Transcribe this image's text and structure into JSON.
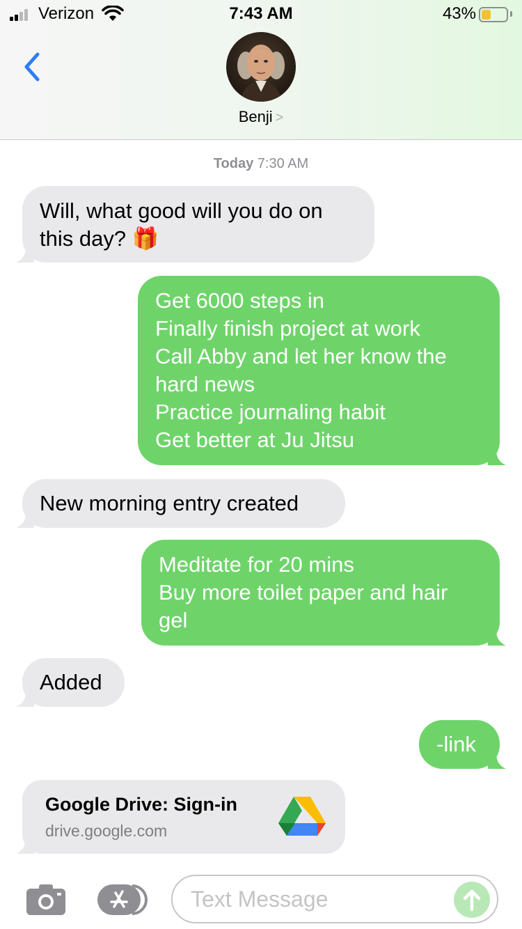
{
  "status_bar": {
    "carrier": "Verizon",
    "time": "7:43 AM",
    "battery_percent": "43%",
    "battery_level": 0.43,
    "signal_bars_active": 2,
    "icons": [
      "signal-icon",
      "wifi-icon",
      "battery-icon"
    ]
  },
  "header": {
    "back_icon": "chevron-left-icon",
    "contact_name": "Benji",
    "contact_chevron": ">"
  },
  "thread": {
    "timestamp_day": "Today",
    "timestamp_time": "7:30 AM",
    "messages": [
      {
        "direction": "incoming",
        "lines": [
          "Will, what good will you do on",
          "this day? 🎁"
        ]
      },
      {
        "direction": "outgoing",
        "lines": [
          "Get 6000 steps in",
          "Finally finish project at work",
          "Call Abby and let her know the",
          "hard news",
          "Practice journaling habit",
          "Get better at Ju Jitsu"
        ]
      },
      {
        "direction": "incoming",
        "lines": [
          "New morning entry created"
        ]
      },
      {
        "direction": "outgoing",
        "lines": [
          "Meditate for 20 mins",
          "Buy more toilet paper and hair",
          "gel"
        ]
      },
      {
        "direction": "incoming",
        "lines": [
          "Added"
        ]
      },
      {
        "direction": "outgoing",
        "lines": [
          "-link"
        ]
      }
    ],
    "link_preview": {
      "title": "Google Drive: Sign-in",
      "url": "drive.google.com",
      "icon": "google-drive-icon"
    }
  },
  "composer": {
    "placeholder": "Text Message",
    "icons": [
      "camera-icon",
      "app-store-icon",
      "send-arrow-icon"
    ]
  },
  "colors": {
    "incoming_bubble": "#e9e9eb",
    "outgoing_bubble": "#6ed46a",
    "accent_blue": "#2f7cf6",
    "battery": "#f2c230"
  }
}
